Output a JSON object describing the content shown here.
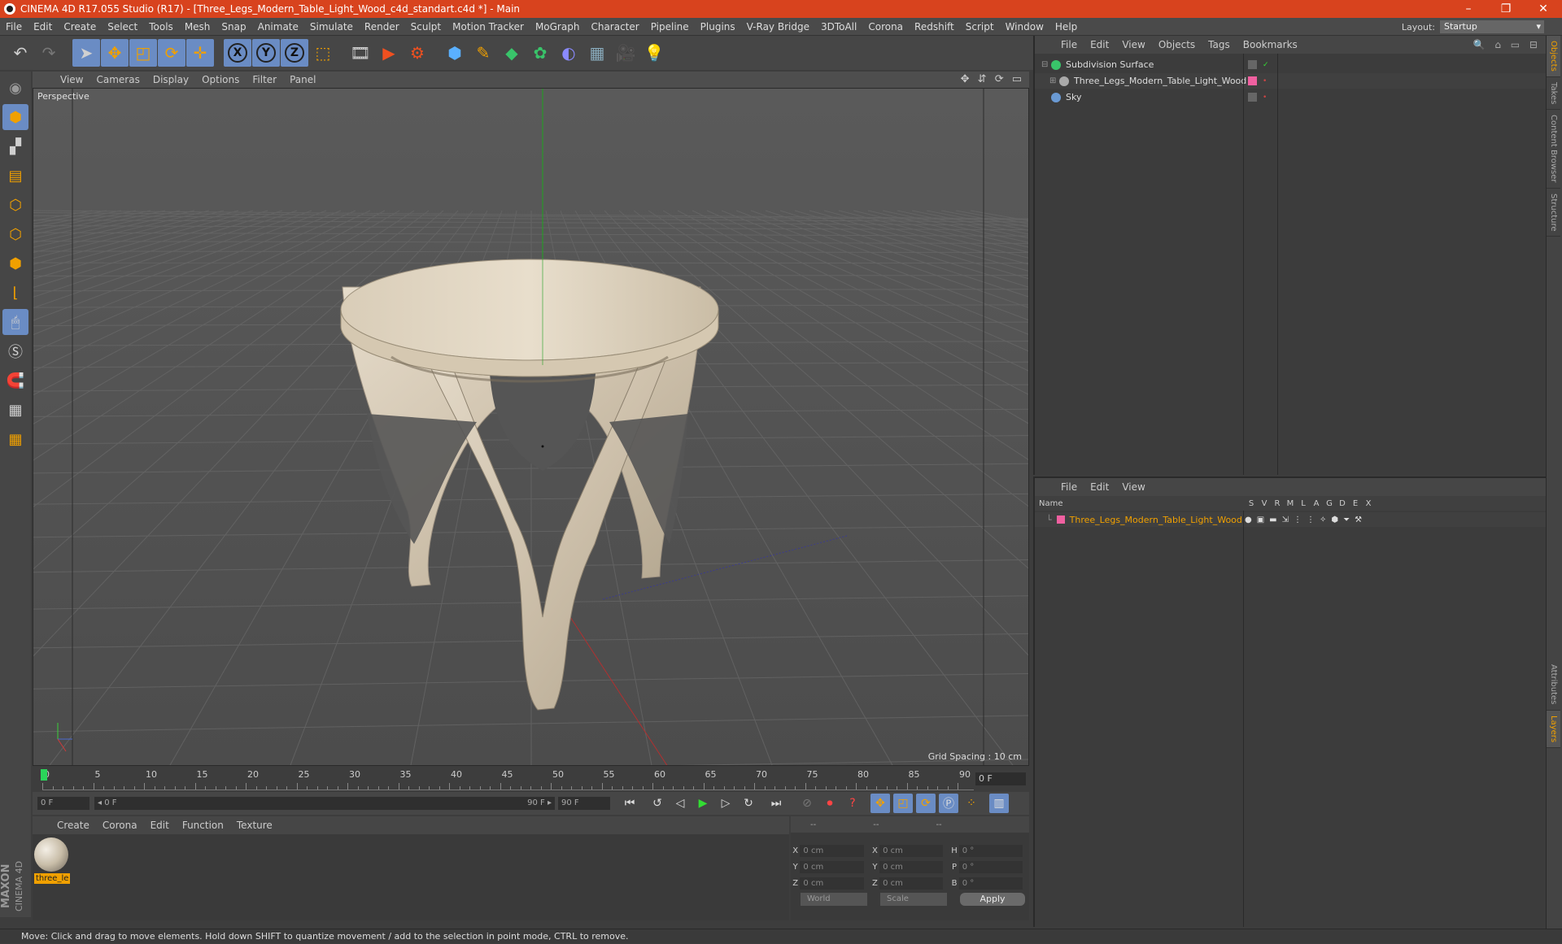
{
  "window": {
    "title": "CINEMA 4D R17.055 Studio (R17) - [Three_Legs_Modern_Table_Light_Wood_c4d_standart.c4d *] - Main",
    "minimize": "–",
    "restore": "❐",
    "close": "✕"
  },
  "menubar": [
    "File",
    "Edit",
    "Create",
    "Select",
    "Tools",
    "Mesh",
    "Snap",
    "Animate",
    "Simulate",
    "Render",
    "Sculpt",
    "Motion Tracker",
    "MoGraph",
    "Character",
    "Pipeline",
    "Plugins",
    "V-Ray Bridge",
    "3DToAll",
    "Corona",
    "Redshift",
    "Script",
    "Window",
    "Help"
  ],
  "layout": {
    "label": "Layout:",
    "value": "Startup"
  },
  "toolbar": {
    "icons": [
      "undo-icon",
      "redo-icon",
      "select-pointer-icon",
      "move-icon",
      "scale-icon",
      "rotate-icon",
      "transform-icon",
      "x-axis-icon",
      "y-axis-icon",
      "z-axis-icon",
      "world-coord-icon",
      "render-view-icon",
      "render-picture-viewer-icon",
      "edit-render-settings-icon",
      "cube-primitive-icon",
      "spline-pen-icon",
      "subdivision-icon",
      "array-icon",
      "deformer-icon",
      "floor-icon",
      "camera-icon",
      "light-icon"
    ],
    "axis_labels": [
      "X",
      "Y",
      "Z"
    ]
  },
  "left_tools": [
    "make-editable-icon",
    "model-mode-icon",
    "texture-mode-icon",
    "workplane-icon",
    "points-mode-icon",
    "edges-mode-icon",
    "polygons-mode-icon",
    "axis-mode-icon",
    "tweak-mode-icon",
    "solo-icon",
    "magnet-icon",
    "snap-grid-icon",
    "snap-settings-icon"
  ],
  "brand": {
    "maxon": "MAXON",
    "c4d": "CINEMA 4D"
  },
  "viewport": {
    "menu": [
      "View",
      "Cameras",
      "Display",
      "Options",
      "Filter",
      "Panel"
    ],
    "icons": "✥ ⇵ ⟳ ▭",
    "label": "Perspective",
    "grid_spacing": "Grid Spacing : 10 cm"
  },
  "timeline": {
    "ticks": [
      "0",
      "5",
      "10",
      "15",
      "20",
      "25",
      "30",
      "35",
      "40",
      "45",
      "50",
      "55",
      "60",
      "65",
      "70",
      "75",
      "80",
      "85",
      "90"
    ],
    "current": "0 F",
    "start_field": "0 F",
    "range_start": "◂ 0 F",
    "range_end": "90 F ▸",
    "end_field": "90 F"
  },
  "material_panel": {
    "menu": [
      "Create",
      "Corona",
      "Edit",
      "Function",
      "Texture"
    ],
    "material_name": "three_le"
  },
  "coords": {
    "head": [
      "--",
      "--",
      "--"
    ],
    "rows": [
      {
        "a": "X",
        "av": "0 cm",
        "b": "X",
        "bv": "0 cm",
        "c": "H",
        "cv": "0 °"
      },
      {
        "a": "Y",
        "av": "0 cm",
        "b": "Y",
        "bv": "0 cm",
        "c": "P",
        "cv": "0 °"
      },
      {
        "a": "Z",
        "av": "0 cm",
        "b": "Z",
        "bv": "0 cm",
        "c": "B",
        "cv": "0 °"
      }
    ],
    "mode1": "World",
    "mode2": "Scale",
    "apply": "Apply"
  },
  "object_manager": {
    "menu": [
      "File",
      "Edit",
      "View",
      "Objects",
      "Tags",
      "Bookmarks"
    ],
    "objects": [
      {
        "name": "Subdivision Surface",
        "color": "#39c46a"
      },
      {
        "name": "Three_Legs_Modern_Table_Light_Wood",
        "color": "#aaaaaa"
      },
      {
        "name": "Sky",
        "color": "#6a9ad4"
      }
    ]
  },
  "layer_manager": {
    "menu": [
      "File",
      "Edit",
      "View"
    ],
    "columns": {
      "name": "Name",
      "flags": [
        "S",
        "V",
        "R",
        "M",
        "L",
        "A",
        "G",
        "D",
        "E",
        "X"
      ]
    },
    "layer": {
      "name": "Three_Legs_Modern_Table_Light_Wood",
      "color": "#f060a0"
    }
  },
  "right_tabs": [
    "Objects",
    "Takes",
    "Content Browser",
    "Structure",
    "Attributes",
    "Layers"
  ],
  "status": "Move: Click and drag to move elements. Hold down SHIFT to quantize movement / add to the selection in point mode, CTRL to remove.",
  "colors": {
    "accent": "#d8431e",
    "highlight": "#6a8cc4",
    "selected_text": "#f0a000"
  }
}
